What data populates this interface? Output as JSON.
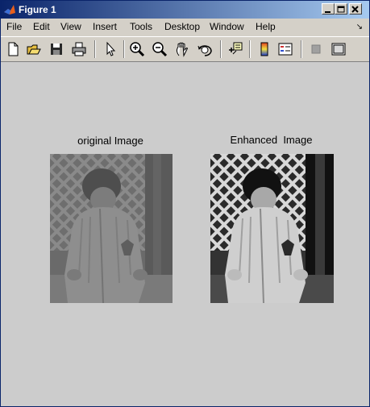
{
  "window": {
    "title": "Figure 1"
  },
  "menu": {
    "items": [
      "File",
      "Edit",
      "View",
      "Insert",
      "Tools",
      "Desktop",
      "Window",
      "Help"
    ],
    "corner_glyph": "↘"
  },
  "toolbar": {
    "icons": [
      "new-figure-icon",
      "open-file-icon",
      "save-icon",
      "print-icon",
      "pointer-icon",
      "zoom-in-icon",
      "zoom-out-icon",
      "pan-icon",
      "rotate-3d-icon",
      "data-cursor-icon",
      "colorbar-icon",
      "legend-icon",
      "hide-plot-tools-icon",
      "show-plot-tools-icon"
    ]
  },
  "figure": {
    "left_title": "original Image",
    "right_title": "Enhanced  Image"
  }
}
